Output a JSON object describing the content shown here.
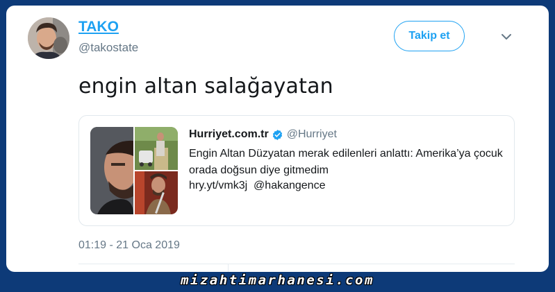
{
  "tweet": {
    "author": {
      "name": "TAKO",
      "handle": "@takostate"
    },
    "follow_label": "Takip et",
    "text": "engin altan salağayatan",
    "timestamp": "01:19 - 21 Oca 2019"
  },
  "quoted": {
    "name": "Hurriyet.com.tr",
    "handle": "@Hurriyet",
    "text": "Engin Altan Düzyatan merak edilenleri anlattı: Amerika’ya çocuk orada doğsun diye gitmedim",
    "link_line": "hry.yt/vmk3j  @hakangence"
  },
  "watermark": "mizahtimarhanesi.com",
  "colors": {
    "accent": "#1da1f2",
    "background": "#0d3a78",
    "secondary_text": "#657786"
  }
}
